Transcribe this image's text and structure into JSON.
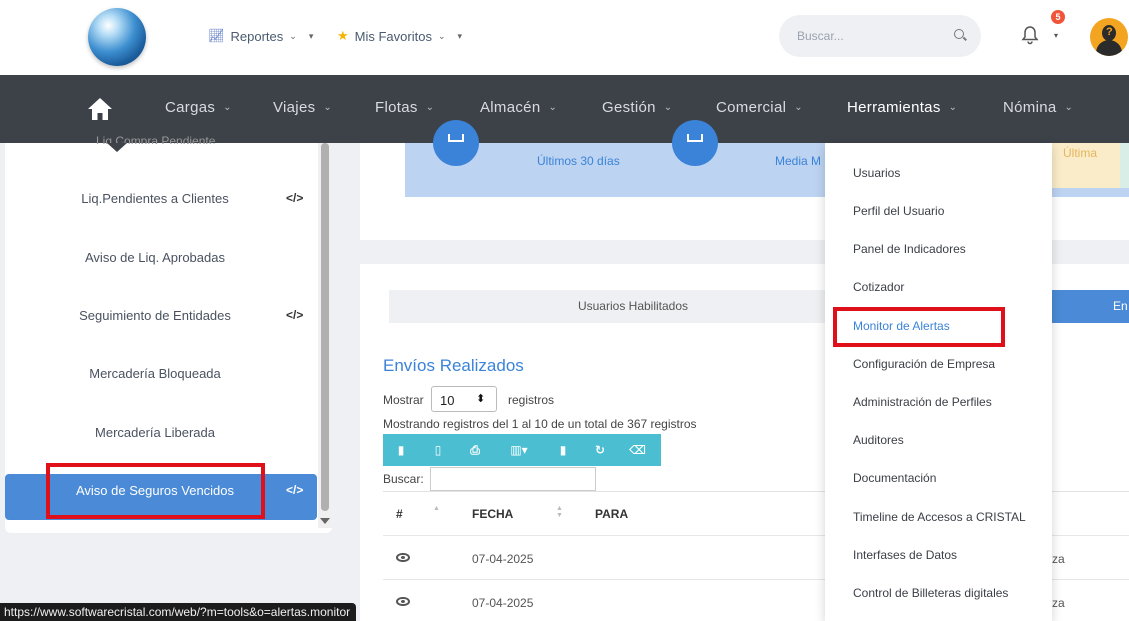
{
  "topbar": {
    "reportes": "Reportes",
    "favoritos": "Mis Favoritos",
    "search_placeholder": "Buscar...",
    "notification_count": "5"
  },
  "nav": {
    "items": [
      "Cargas",
      "Viajes",
      "Flotas",
      "Almacén",
      "Gestión",
      "Comercial",
      "Herramientas",
      "Nómina"
    ]
  },
  "sidebar": {
    "cut_item": "Liq.Compra Pendiente",
    "items": [
      {
        "label": "Liq.Pendientes a Clientes",
        "code": "</>"
      },
      {
        "label": "Aviso de Liq. Aprobadas",
        "code": ""
      },
      {
        "label": "Seguimiento de Entidades",
        "code": "</>"
      },
      {
        "label": "Mercadería Bloqueada",
        "code": ""
      },
      {
        "label": "Mercadería Liberada",
        "code": ""
      }
    ],
    "active": {
      "label": "Aviso de Seguros Vencidos",
      "code": "</>"
    }
  },
  "stats": {
    "last30": "Últimos 30 días",
    "media": "Media M",
    "ultima": "Última"
  },
  "tabs": {
    "users": "Usuarios Habilitados",
    "blue": "En"
  },
  "envios": {
    "title": "Envíos Realizados",
    "mostrar": "Mostrar",
    "page_size": "10",
    "registros": "registros",
    "mostrando": "Mostrando registros del 1 al 10 de un total de 367 registros",
    "buscar": "Buscar:",
    "headers": {
      "num": "#",
      "fecha": "FECHA",
      "para": "PARA"
    },
    "rows": [
      {
        "fecha": "07-04-2025",
        "tail": "za"
      },
      {
        "fecha": "07-04-2025",
        "tail": "za"
      }
    ]
  },
  "dropdown": {
    "items": [
      "Usuarios",
      "Perfil del Usuario",
      "Panel de Indicadores",
      "Cotizador",
      "Monitor de Alertas",
      "Configuración de Empresa",
      "Administración de Perfiles",
      "Auditores",
      "Documentación",
      "Timeline de Accesos a CRISTAL",
      "Interfases de Datos",
      "Control de Billeteras digitales"
    ],
    "highlighted_index": 4
  },
  "status_url": "https://www.softwarecristal.com/web/?m=tools&o=alertas.monitor",
  "colors": {
    "accent": "#3b83d8",
    "nav_bg": "#3d4249",
    "highlight": "#e0101a",
    "toolbar": "#4bbfd1"
  }
}
